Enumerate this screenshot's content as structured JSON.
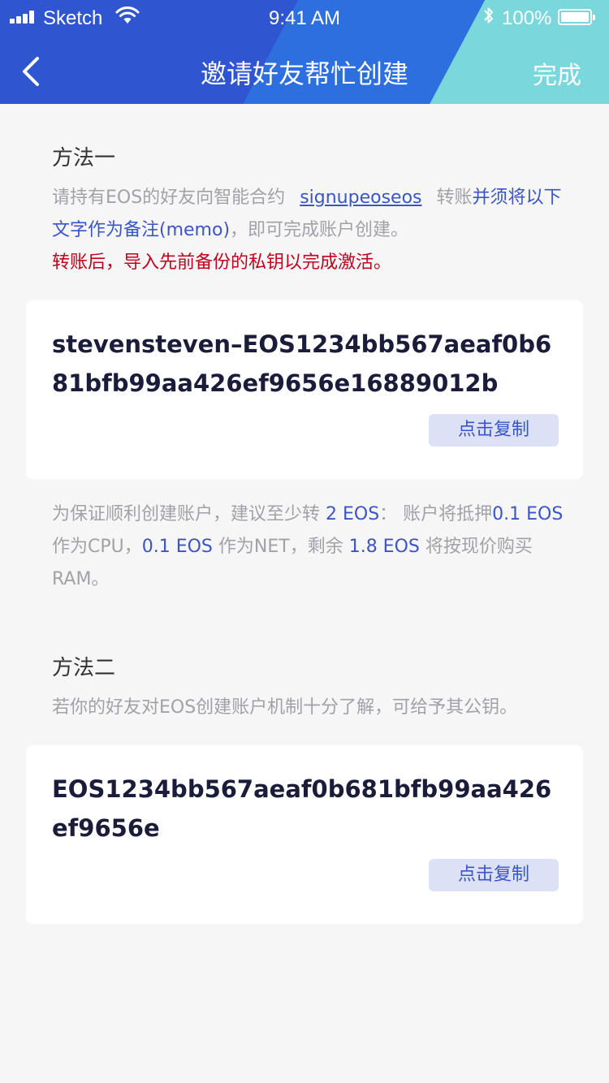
{
  "status_bar": {
    "carrier": "Sketch",
    "time": "9:41 AM",
    "battery": "100%"
  },
  "nav": {
    "title": "邀请好友帮忙创建",
    "done_label": "完成"
  },
  "method1": {
    "title": "方法一",
    "desc_prefix": "请持有EOS的好友向智能合约",
    "contract": "signupeoseos",
    "desc_transfer": "转账",
    "desc_blue": "并须将以下文字作为备注(memo)",
    "desc_suffix": "，即可完成账户创建。",
    "warning": "转账后，导入先前备份的私钥以完成激活。",
    "memo": "stevensteven–EOS1234bb567aeaf0b681bfb99aa426ef9656e16889012b",
    "copy_label": "点击复制",
    "note_1": "为保证顺利创建账户，建议至少转 ",
    "note_amount_total": "2 EOS",
    "note_2": "： 账户将抵押",
    "note_cpu": "0.1 EOS",
    "note_3": " 作为CPU，",
    "note_net": "0.1 EOS",
    "note_4": " 作为NET，剩余 ",
    "note_ram": "1.8 EOS",
    "note_5": " 将按现价购买RAM。"
  },
  "method2": {
    "title": "方法二",
    "desc": "若你的好友对EOS创建账户机制十分了解，可给予其公钥。",
    "public_key": "EOS1234bb567aeaf0b681bfb99aa426ef9656e",
    "copy_label": "点击复制"
  },
  "colors": {
    "accent_blue": "#3b55c8",
    "warning_red": "#c2001b",
    "header_blue": "#2f55d1",
    "header_teal": "#7ad7dc"
  }
}
